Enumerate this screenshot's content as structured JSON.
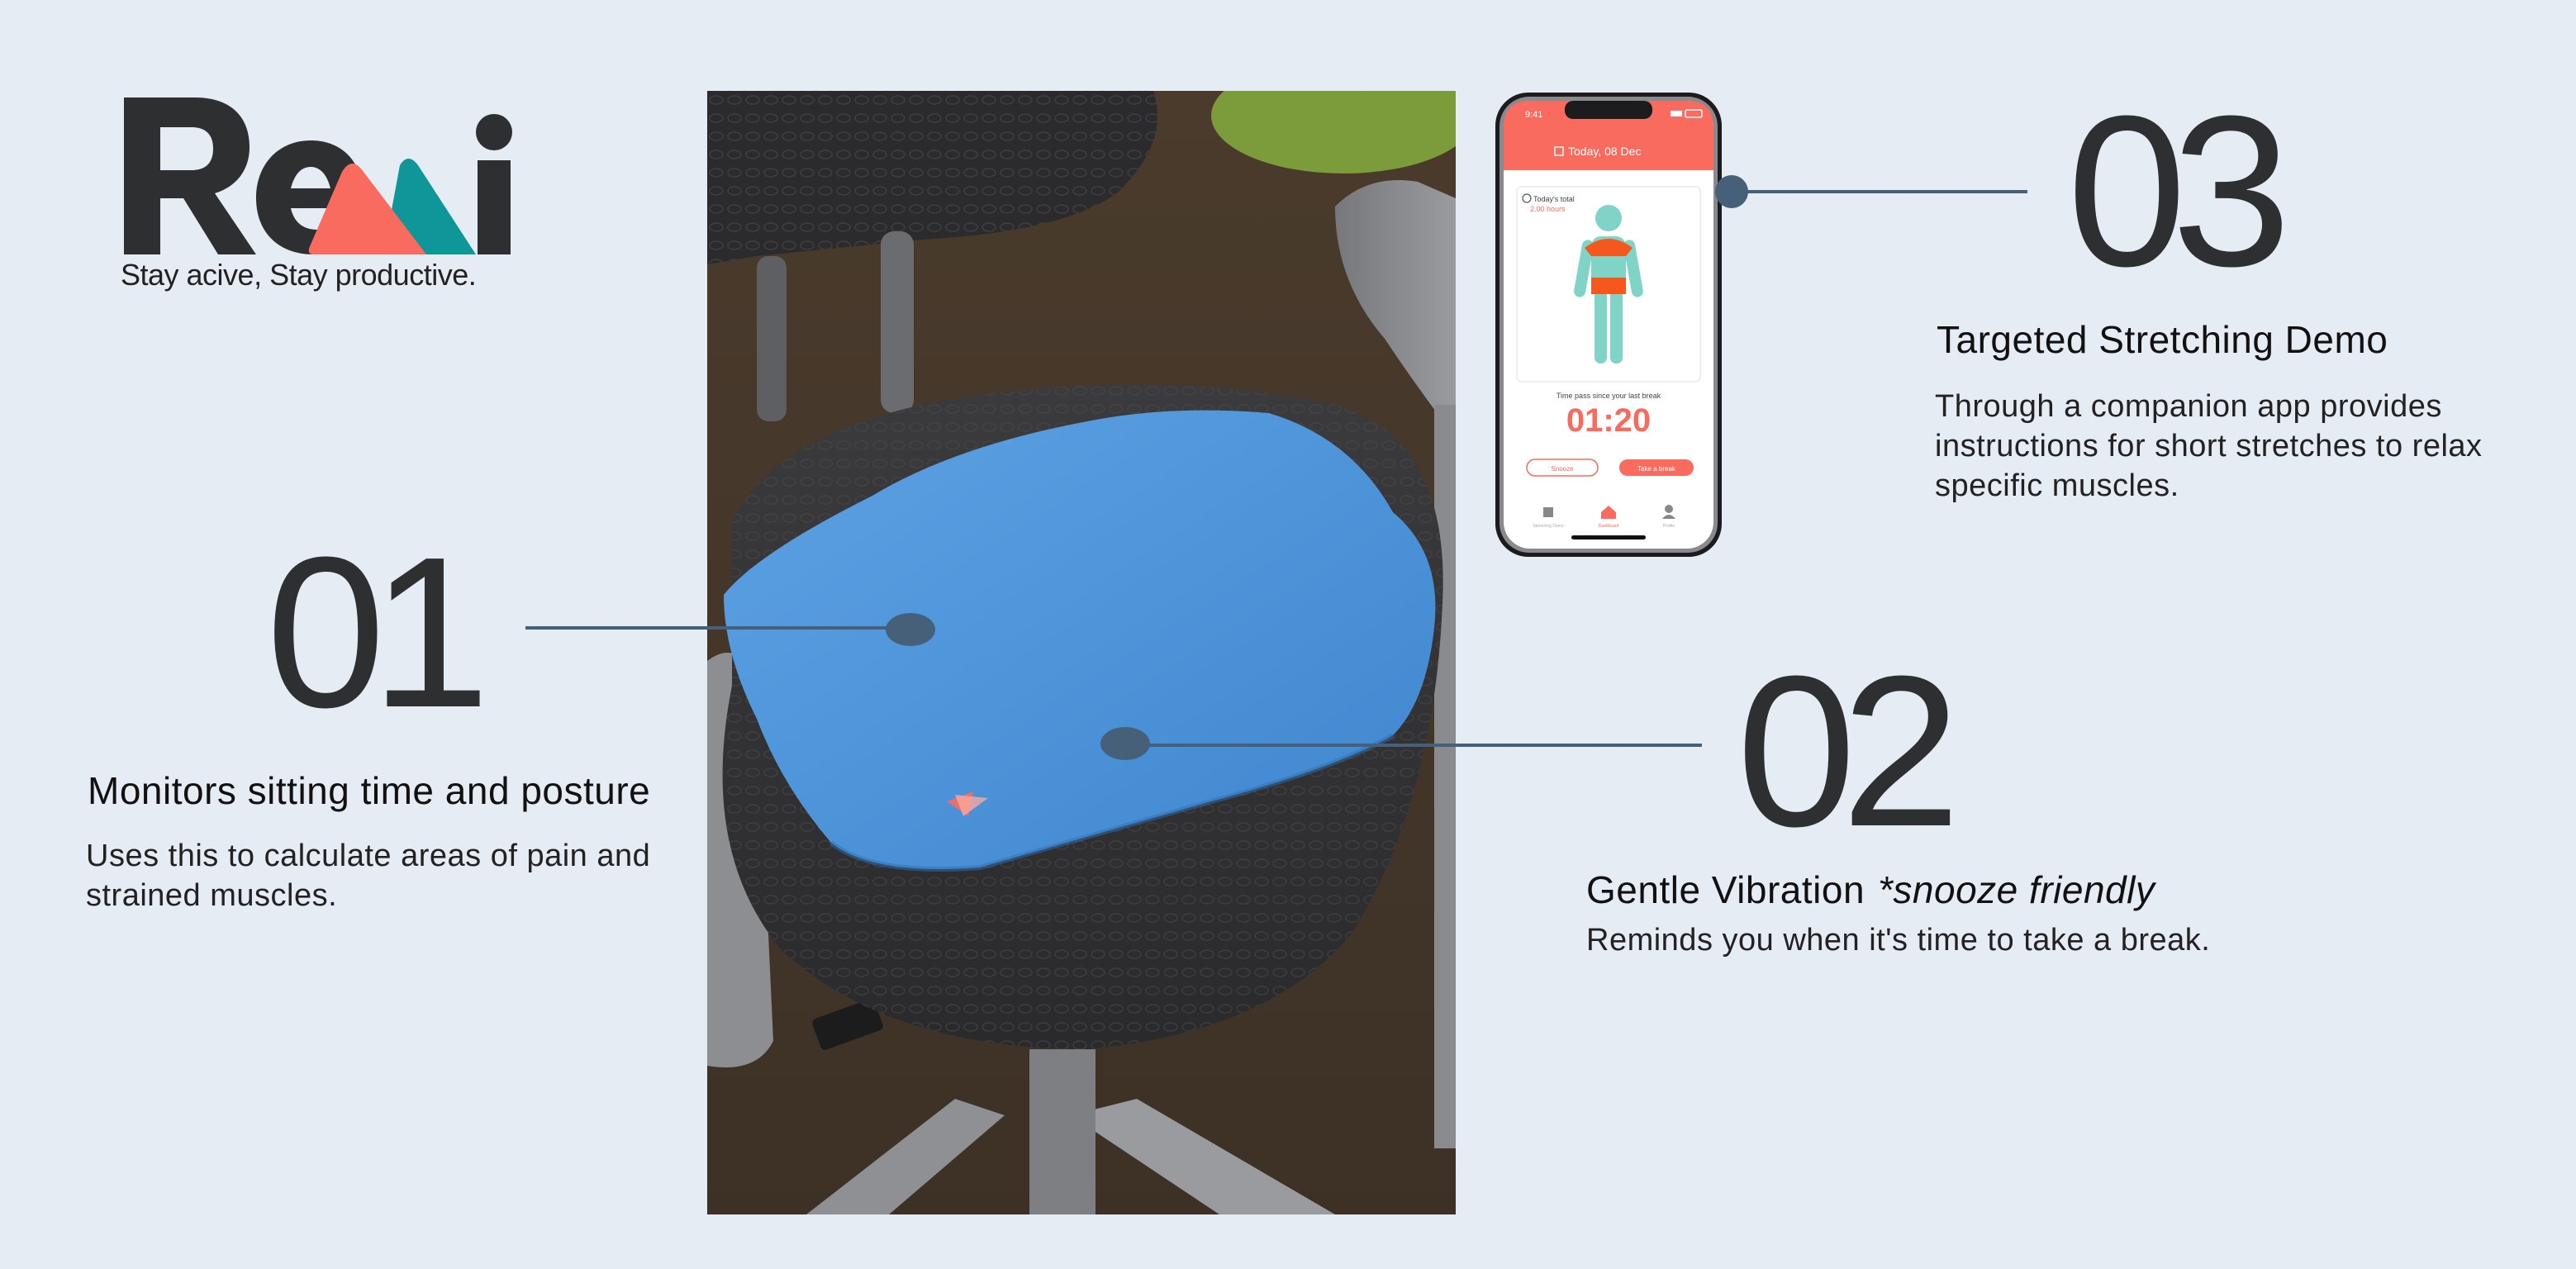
{
  "logo": {
    "text": "Remi",
    "tagline": "Stay acive, Stay productive."
  },
  "feature1": {
    "number": "01",
    "title": "Monitors sitting time and posture",
    "description": "Uses this to calculate areas of pain and strained muscles."
  },
  "feature2": {
    "number": "02",
    "title": "Gentle Vibration",
    "title_note": "*snooze friendly",
    "description": "Reminds you when it's time to take a break."
  },
  "feature3": {
    "number": "03",
    "title": "Targeted Stretching Demo",
    "description": "Through a companion app provides instructions for short stretches to relax specific muscles."
  },
  "phone": {
    "time": "9:41",
    "date": "Today, 08 Dec",
    "today_total_label": "Today's total",
    "today_total_value": "2.00 hours",
    "since_break_label": "Time pass since your last break",
    "timer": "01:20",
    "snooze_label": "Snooze",
    "break_label": "Take a break",
    "nav": [
      "Stretching Demo",
      "Dashboard",
      "Profile"
    ]
  },
  "colors": {
    "background": "#e6ecf4",
    "coral": "#f96b5f",
    "teal": "#0f9698",
    "dark": "#2e2f31",
    "connector": "#47607a",
    "cushion": "#4a91d6"
  }
}
